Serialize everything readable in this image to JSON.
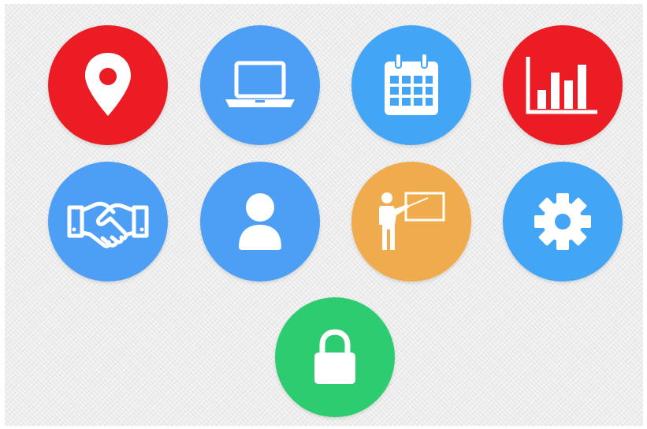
{
  "tiles": [
    {
      "name": "location",
      "icon": "map-pin-icon",
      "color": "#ec1c24"
    },
    {
      "name": "laptop",
      "icon": "laptop-icon",
      "color": "#4d9ff5"
    },
    {
      "name": "calendar",
      "icon": "calendar-icon",
      "color": "#42a5f5"
    },
    {
      "name": "analytics",
      "icon": "bar-chart-icon",
      "color": "#ec1c24"
    },
    {
      "name": "partnership",
      "icon": "handshake-icon",
      "color": "#4d9ff5"
    },
    {
      "name": "user",
      "icon": "user-icon",
      "color": "#4d9ff5"
    },
    {
      "name": "presentation",
      "icon": "presenter-icon",
      "color": "#f0ab4c"
    },
    {
      "name": "settings",
      "icon": "gear-icon",
      "color": "#42a5f5"
    },
    {
      "name": "security",
      "icon": "lock-icon",
      "color": "#2ecc71"
    }
  ]
}
